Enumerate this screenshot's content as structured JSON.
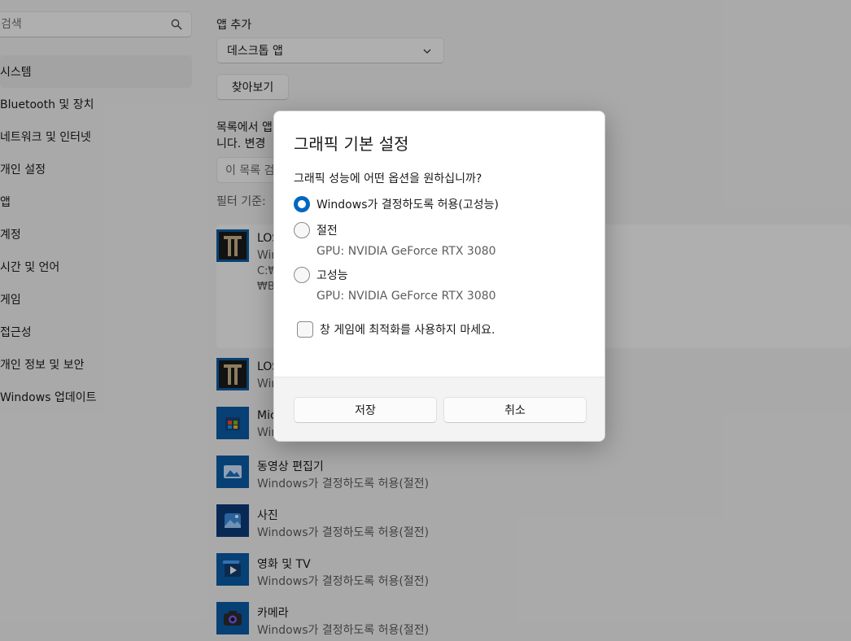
{
  "sidebar": {
    "search_placeholder": "검색",
    "items": [
      {
        "label": "시스템",
        "selected": true
      },
      {
        "label": "Bluetooth 및 장치"
      },
      {
        "label": "네트워크 및 인터넷"
      },
      {
        "label": "개인 설정"
      },
      {
        "label": "앱"
      },
      {
        "label": "계정"
      },
      {
        "label": "시간 및 언어"
      },
      {
        "label": "게임"
      },
      {
        "label": "접근성"
      },
      {
        "label": "개인 정보 및 보안"
      },
      {
        "label": "Windows 업데이트"
      }
    ]
  },
  "main": {
    "add_app_label": "앱 추가",
    "app_type_selected": "데스크톱 앱",
    "browse_label": "찾아보기",
    "desc_line1": "목록에서 앱",
    "desc_line2": "니다. 변경",
    "list_search_placeholder": "이 목록 검",
    "filter_label": "필터 기준:",
    "apps": [
      {
        "name": "LOS",
        "sub": "Win",
        "path1": "C:₩",
        "path2": "₩B",
        "icon": "lost-ark-icon"
      },
      {
        "name": "LOS",
        "sub": "Win",
        "icon": "lost-ark-icon"
      },
      {
        "name": "Mic",
        "sub": "Win",
        "icon": "microsoft-store-icon"
      },
      {
        "name": "동영상 편집기",
        "sub": "Windows가 결정하도록 허용(절전)",
        "icon": "video-editor-icon"
      },
      {
        "name": "사진",
        "sub": "Windows가 결정하도록 허용(절전)",
        "icon": "photos-icon"
      },
      {
        "name": "영화 및 TV",
        "sub": "Windows가 결정하도록 허용(절전)",
        "icon": "movies-tv-icon"
      },
      {
        "name": "카메라",
        "sub": "Windows가 결정하도록 허용(절전)",
        "icon": "camera-icon"
      }
    ]
  },
  "dialog": {
    "title": "그래픽 기본 설정",
    "question": "그래픽 성능에 어떤 옵션을 원하십니까?",
    "options": [
      {
        "label": "Windows가 결정하도록 허용(고성능)",
        "checked": true
      },
      {
        "label": "절전",
        "sub": "GPU: NVIDIA GeForce RTX 3080",
        "checked": false
      },
      {
        "label": "고성능",
        "sub": "GPU: NVIDIA GeForce RTX 3080",
        "checked": false
      }
    ],
    "checkbox_label": "창 게임에 최적화를 사용하지 마세요.",
    "checkbox_checked": false,
    "save_label": "저장",
    "cancel_label": "취소"
  },
  "colors": {
    "accent": "#0067c0",
    "app_tile": "#0a5ca8"
  }
}
